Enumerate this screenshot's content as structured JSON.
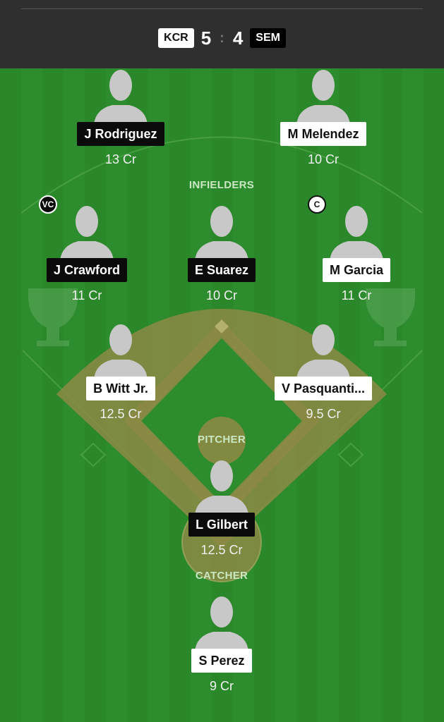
{
  "header": {
    "home_team": "KCR",
    "away_team": "SEM",
    "home_score": "5",
    "away_score": "4",
    "separator": ":"
  },
  "sections": {
    "infielders": "INFIELDERS",
    "pitcher": "PITCHER",
    "catcher": "CATCHER"
  },
  "players": {
    "j_rodriguez": {
      "name": "J Rodriguez",
      "credits": "13 Cr"
    },
    "m_melendez": {
      "name": "M Melendez",
      "credits": "10 Cr"
    },
    "j_crawford": {
      "name": "J Crawford",
      "credits": "11 Cr",
      "badge": "VC"
    },
    "e_suarez": {
      "name": "E Suarez",
      "credits": "10 Cr"
    },
    "m_garcia": {
      "name": "M Garcia",
      "credits": "11 Cr",
      "badge": "C"
    },
    "b_witt": {
      "name": "B Witt Jr.",
      "credits": "12.5 Cr"
    },
    "v_pasquantino": {
      "name": "V Pasquanti...",
      "credits": "9.5 Cr"
    },
    "l_gilbert": {
      "name": "L Gilbert",
      "credits": "12.5 Cr"
    },
    "s_perez": {
      "name": "S Perez",
      "credits": "9 Cr"
    }
  },
  "colors": {
    "home_team_tag": "#ffffff",
    "away_team_tag": "#000000",
    "field_green": "#2e8f2e",
    "infield_dirt": "#8c8a45"
  }
}
